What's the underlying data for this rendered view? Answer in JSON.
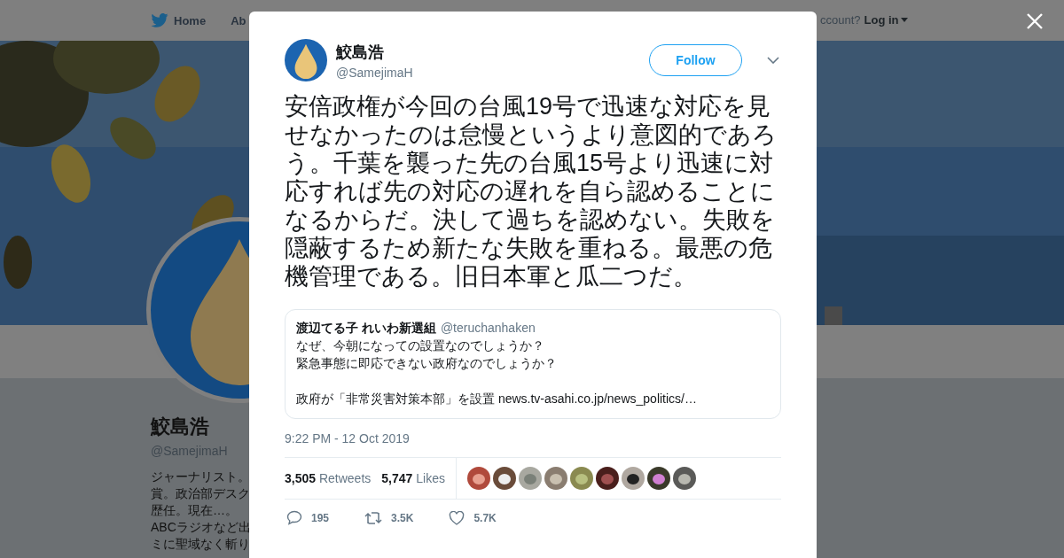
{
  "nav": {
    "items": [
      {
        "label": "Home",
        "kind": "home"
      },
      {
        "label": "Ab",
        "kind": "plain"
      }
    ],
    "account_prompt": "ccount?",
    "login": "Log in"
  },
  "profile": {
    "name": "鮫島浩",
    "handle": "@SamejimaH",
    "bio_lines": [
      "ジャーナリスト。",
      "賞。政治部デスク",
      "歴任。現在…。",
      "ABCラジオなど出",
      "ミに聖域なく斬り"
    ]
  },
  "tweet": {
    "author": {
      "name": "鮫島浩",
      "handle": "@SamejimaH"
    },
    "follow_label": "Follow",
    "text": "安倍政権が今回の台風19号で迅速な対応を見せなかったのは怠慢というより意図的であろう。千葉を襲った先の台風15号より迅速に対応すれば先の対応の遅れを自ら認めることになるからだ。決して過ちを認めない。失敗を隠蔽するため新たな失敗を重ねる。最悪の危機管理である。旧日本軍と瓜二つだ。",
    "quote": {
      "name": "渡辺てる子 れいわ新選組",
      "handle": "@teruchanhaken",
      "paragraphs": [
        [
          "なぜ、今朝になっての設置なのでしょうか？",
          "緊急事態に即応できない政府なのでしょうか？"
        ],
        [
          "政府が「非常災害対策本部」を設置 news.tv-asahi.co.jp/news_politics/…"
        ]
      ]
    },
    "timestamp": "9:22 PM - 12 Oct 2019",
    "stats": [
      {
        "count": "3,505",
        "label": "Retweets"
      },
      {
        "count": "5,747",
        "label": "Likes"
      }
    ],
    "actions": [
      {
        "kind": "reply",
        "count": "195"
      },
      {
        "kind": "retweet",
        "count": "3.5K"
      },
      {
        "kind": "like",
        "count": "5.7K"
      }
    ]
  }
}
